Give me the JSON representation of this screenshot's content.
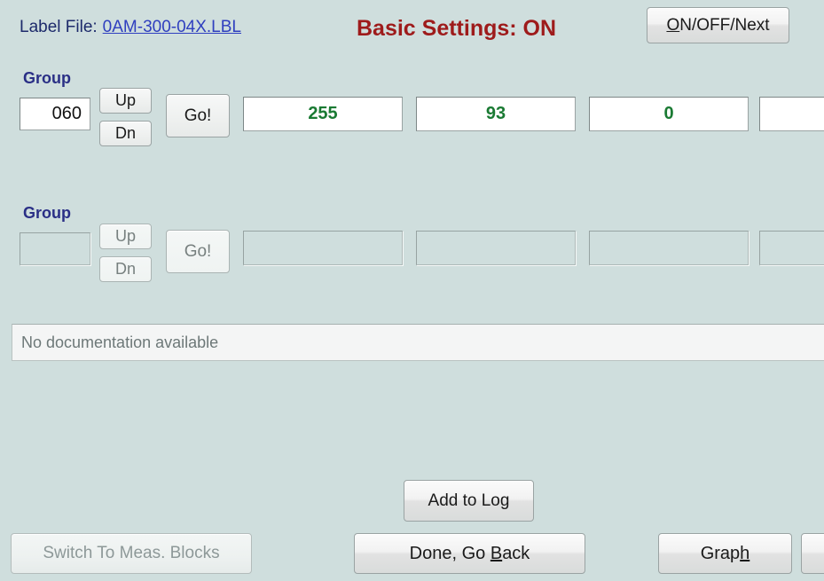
{
  "window": {
    "background_color": "#cfdedd"
  },
  "header": {
    "label_file_caption": "Label File:",
    "label_file_name": "0AM-300-04X.LBL",
    "title": "Basic Settings: ON",
    "title_color": "#9e1b1b",
    "onoff_next_button": {
      "accel": "O",
      "rest": "N/OFF/Next"
    }
  },
  "groups": [
    {
      "label": "Group",
      "group_number": "060",
      "up_label": "Up",
      "dn_label": "Dn",
      "go_label": "Go!",
      "enabled": true,
      "values": [
        "255",
        "93",
        "0",
        ""
      ],
      "value_color": "#1a7a33"
    },
    {
      "label": "Group",
      "group_number": "",
      "up_label": "Up",
      "dn_label": "Dn",
      "go_label": "Go!",
      "enabled": false,
      "values": [
        "",
        "",
        "",
        ""
      ],
      "value_color": "#1a7a33"
    }
  ],
  "documentation": {
    "text": "No documentation available"
  },
  "footer": {
    "add_to_log_label": "Add to Log",
    "switch_meas_blocks_label": "Switch To Meas. Blocks",
    "done_go_back": {
      "pre": "Done, Go ",
      "accel": "B",
      "post": "ack"
    },
    "graph": {
      "pre": "Grap",
      "accel": "h"
    },
    "extra_button_label": ""
  }
}
